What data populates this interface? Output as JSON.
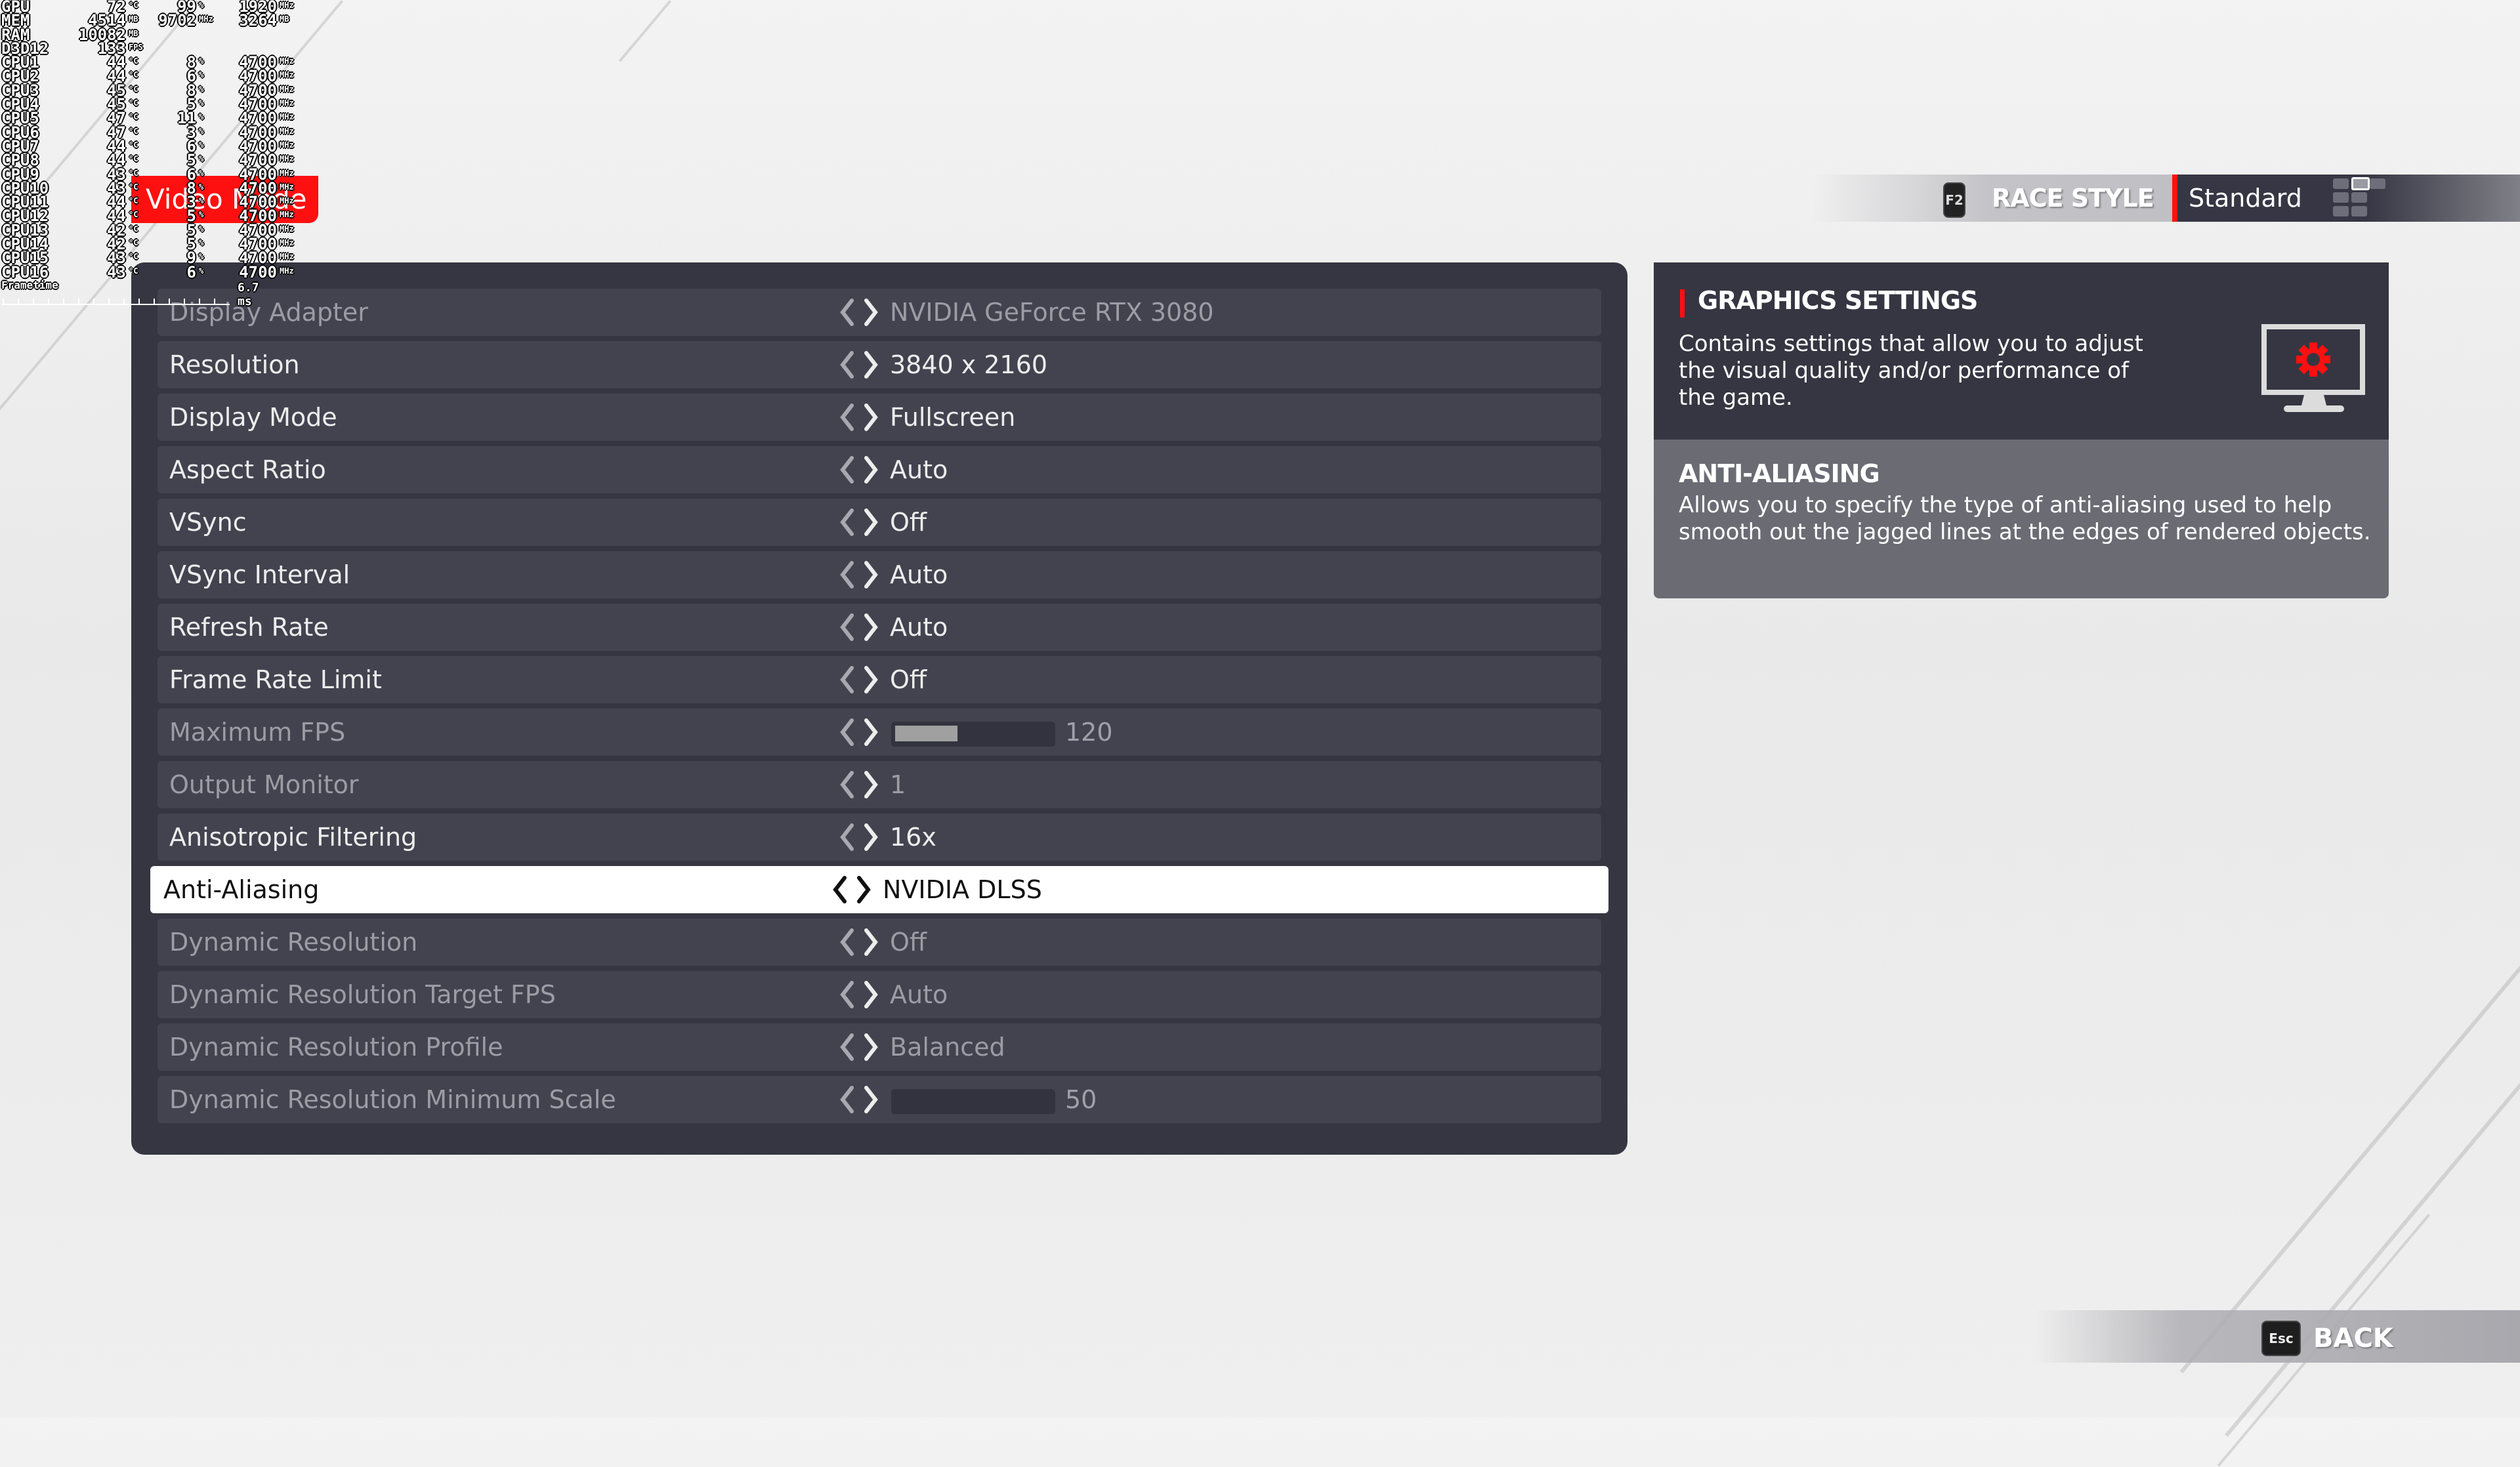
{
  "osd": {
    "rows": [
      {
        "label": "GPU",
        "v1": "72",
        "u1": "°C",
        "v2": "99",
        "u2": "%",
        "v3": "1920",
        "u3": "MHz"
      },
      {
        "label": "MEM",
        "v1": "4514",
        "u1": "MB",
        "v2": "9702",
        "u2": "MHz",
        "v3": "3264",
        "u3": "MB"
      },
      {
        "label": "RAM",
        "v1": "10082",
        "u1": "MB",
        "v2": "",
        "u2": "",
        "v3": "",
        "u3": ""
      },
      {
        "label": "D3D12",
        "v1": "133",
        "u1": "FPS",
        "v2": "",
        "u2": "",
        "v3": "",
        "u3": ""
      },
      {
        "label": "CPU1",
        "v1": "44",
        "u1": "°C",
        "v2": "8",
        "u2": "%",
        "v3": "4700",
        "u3": "MHz"
      },
      {
        "label": "CPU2",
        "v1": "44",
        "u1": "°C",
        "v2": "6",
        "u2": "%",
        "v3": "4700",
        "u3": "MHz"
      },
      {
        "label": "CPU3",
        "v1": "45",
        "u1": "°C",
        "v2": "8",
        "u2": "%",
        "v3": "4700",
        "u3": "MHz"
      },
      {
        "label": "CPU4",
        "v1": "45",
        "u1": "°C",
        "v2": "5",
        "u2": "%",
        "v3": "4700",
        "u3": "MHz"
      },
      {
        "label": "CPU5",
        "v1": "47",
        "u1": "°C",
        "v2": "11",
        "u2": "%",
        "v3": "4700",
        "u3": "MHz"
      },
      {
        "label": "CPU6",
        "v1": "47",
        "u1": "°C",
        "v2": "3",
        "u2": "%",
        "v3": "4700",
        "u3": "MHz"
      },
      {
        "label": "CPU7",
        "v1": "44",
        "u1": "°C",
        "v2": "6",
        "u2": "%",
        "v3": "4700",
        "u3": "MHz"
      },
      {
        "label": "CPU8",
        "v1": "44",
        "u1": "°C",
        "v2": "5",
        "u2": "%",
        "v3": "4700",
        "u3": "MHz"
      },
      {
        "label": "CPU9",
        "v1": "43",
        "u1": "°C",
        "v2": "6",
        "u2": "%",
        "v3": "4700",
        "u3": "MHz"
      },
      {
        "label": "CPU10",
        "v1": "43",
        "u1": "°C",
        "v2": "8",
        "u2": "%",
        "v3": "4700",
        "u3": "MHz"
      },
      {
        "label": "CPU11",
        "v1": "44",
        "u1": "°C",
        "v2": "3",
        "u2": "%",
        "v3": "4700",
        "u3": "MHz"
      },
      {
        "label": "CPU12",
        "v1": "44",
        "u1": "°C",
        "v2": "5",
        "u2": "%",
        "v3": "4700",
        "u3": "MHz"
      },
      {
        "label": "CPU13",
        "v1": "42",
        "u1": "°C",
        "v2": "5",
        "u2": "%",
        "v3": "4700",
        "u3": "MHz"
      },
      {
        "label": "CPU14",
        "v1": "42",
        "u1": "°C",
        "v2": "5",
        "u2": "%",
        "v3": "4700",
        "u3": "MHz"
      },
      {
        "label": "CPU15",
        "v1": "43",
        "u1": "°C",
        "v2": "9",
        "u2": "%",
        "v3": "4700",
        "u3": "MHz"
      },
      {
        "label": "CPU16",
        "v1": "43",
        "u1": "°C",
        "v2": "6",
        "u2": "%",
        "v3": "4700",
        "u3": "MHz"
      }
    ],
    "frametime_label": "Frametime",
    "frametime_value": "6.7 ms"
  },
  "header": {
    "section_tag": "Video Mode",
    "race_style_key": "F2",
    "race_style_label": "RACE STYLE",
    "race_style_value": "Standard"
  },
  "settings": [
    {
      "label": "Display Adapter",
      "value": "NVIDIA GeForce RTX 3080",
      "state": "disabled"
    },
    {
      "label": "Resolution",
      "value": "3840 x 2160",
      "state": "enabled"
    },
    {
      "label": "Display Mode",
      "value": "Fullscreen",
      "state": "enabled"
    },
    {
      "label": "Aspect Ratio",
      "value": "Auto",
      "state": "enabled"
    },
    {
      "label": "VSync",
      "value": "Off",
      "state": "enabled"
    },
    {
      "label": "VSync Interval",
      "value": "Auto",
      "state": "enabled"
    },
    {
      "label": "Refresh Rate",
      "value": "Auto",
      "state": "enabled"
    },
    {
      "label": "Frame Rate Limit",
      "value": "Off",
      "state": "enabled"
    },
    {
      "label": "Maximum FPS",
      "value": "120",
      "state": "disabled",
      "slider_fraction": 0.4
    },
    {
      "label": "Output Monitor",
      "value": "1",
      "state": "disabled"
    },
    {
      "label": "Anisotropic Filtering",
      "value": "16x",
      "state": "enabled"
    },
    {
      "label": "Anti-Aliasing",
      "value": "NVIDIA DLSS",
      "state": "selected"
    },
    {
      "label": "Dynamic Resolution",
      "value": "Off",
      "state": "disabled"
    },
    {
      "label": "Dynamic Resolution Target FPS",
      "value": "Auto",
      "state": "disabled"
    },
    {
      "label": "Dynamic Resolution Profile",
      "value": "Balanced",
      "state": "disabled"
    },
    {
      "label": "Dynamic Resolution Minimum Scale",
      "value": "50",
      "state": "disabled",
      "slider_fraction": 0.0
    }
  ],
  "info": {
    "title": "GRAPHICS SETTINGS",
    "description": "Contains settings that allow you to adjust the visual quality and/or performance of the game.",
    "sub_title": "ANTI-ALIASING",
    "sub_description": "Allows you to specify the type of anti-aliasing used to help smooth out the jagged lines at the edges of rendered objects.",
    "icon": "monitor-gear-icon"
  },
  "footer": {
    "back_key": "Esc",
    "back_label": "BACK"
  },
  "colors": {
    "accent": "#ff1010",
    "panel": "#363642",
    "row": "#434350",
    "selected_row": "#ffffff",
    "info_bottom": "#6b6b74"
  }
}
